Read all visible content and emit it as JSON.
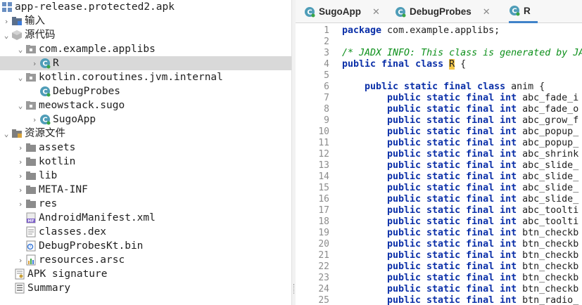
{
  "tree": {
    "root": "app-release.protected2.apk",
    "input": "输入",
    "source": "源代码",
    "pkg_applibs": "com.example.applibs",
    "class_r": "R",
    "pkg_kotlin": "kotlin.coroutines.jvm.internal",
    "class_debugprobes": "DebugProbes",
    "pkg_sugo": "meowstack.sugo",
    "class_sugoapp": "SugoApp",
    "resources": "资源文件",
    "assets": "assets",
    "kotlin": "kotlin",
    "lib": "lib",
    "metainf": "META-INF",
    "res": "res",
    "manifest": "AndroidManifest.xml",
    "dex": "classes.dex",
    "debugbin": "DebugProbesKt.bin",
    "arsc": "resources.arsc",
    "apksig": "APK signature",
    "summary": "Summary"
  },
  "tabs": [
    {
      "label": "SugoApp",
      "close": "✕"
    },
    {
      "label": "DebugProbes",
      "close": "✕"
    },
    {
      "label": "R",
      "close": ""
    }
  ],
  "editor": {
    "line_numbers": [
      "1",
      "2",
      "3",
      "4",
      "5",
      "6",
      "7",
      "8",
      "9",
      "10",
      "11",
      "12",
      "13",
      "14",
      "15",
      "16",
      "17",
      "18",
      "19",
      "20",
      "21",
      "22",
      "23",
      "24",
      "25"
    ],
    "pkg_kw": "package",
    "pkg_name": " com.example.applibs;",
    "comment": "/* JADX INFO: This class is generated by JA",
    "class_decl_kw": "public final class",
    "class_name": "R",
    "class_open": " {",
    "inner_kw": "public static final class",
    "inner_name": " anim {",
    "field_kw": "public static final int",
    "fields": [
      "abc_fade_i",
      "abc_fade_o",
      "abc_grow_f",
      "abc_popup_",
      "abc_popup_",
      "abc_shrink",
      "abc_slide_",
      "abc_slide_",
      "abc_slide_",
      "abc_slide_",
      "abc_toolti",
      "abc_toolti",
      "btn_checkb",
      "btn_checkb",
      "btn_checkb",
      "btn_checkb",
      "btn_checkb",
      "btn_checkb",
      "btn_radio_"
    ]
  },
  "colors": {
    "keyword": "#0a2fa8",
    "comment": "#0c8f1a",
    "selection": "#d9d9d9",
    "active_tab_accent": "#4083c9"
  }
}
